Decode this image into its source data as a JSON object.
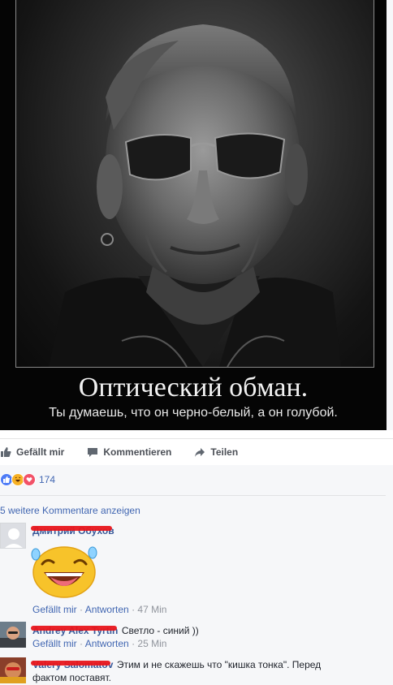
{
  "poster": {
    "title": "Оптический обман.",
    "subtitle": "Ты думаешь, что он черно-белый, а он голубой."
  },
  "actions": {
    "like_label": "Gefällt mir",
    "comment_label": "Kommentieren",
    "share_label": "Teilen"
  },
  "reactions": {
    "count": "174",
    "types": [
      "like-icon",
      "haha-icon",
      "love-icon"
    ]
  },
  "more_comments": "5 weitere Kommentare anzeigen",
  "comments": [
    {
      "author": "Дмитрий Обухов",
      "sticker": "laughing-sticker",
      "like_label": "Gefällt mir",
      "reply_label": "Antworten",
      "time": "47 Min"
    },
    {
      "author": "Andrey Alex Tyrtin",
      "text": "Светло - синий ))",
      "like_label": "Gefällt mir",
      "reply_label": "Antworten",
      "time": "25 Min"
    },
    {
      "author": "Valery Salomatov",
      "text": "Этим и не скажешь что \"кишка тонка\". Перед фактом поставят."
    }
  ],
  "colors": {
    "link": "#4267b2",
    "name": "#385898",
    "meta": "#90949c",
    "redact": "#e8161c"
  }
}
